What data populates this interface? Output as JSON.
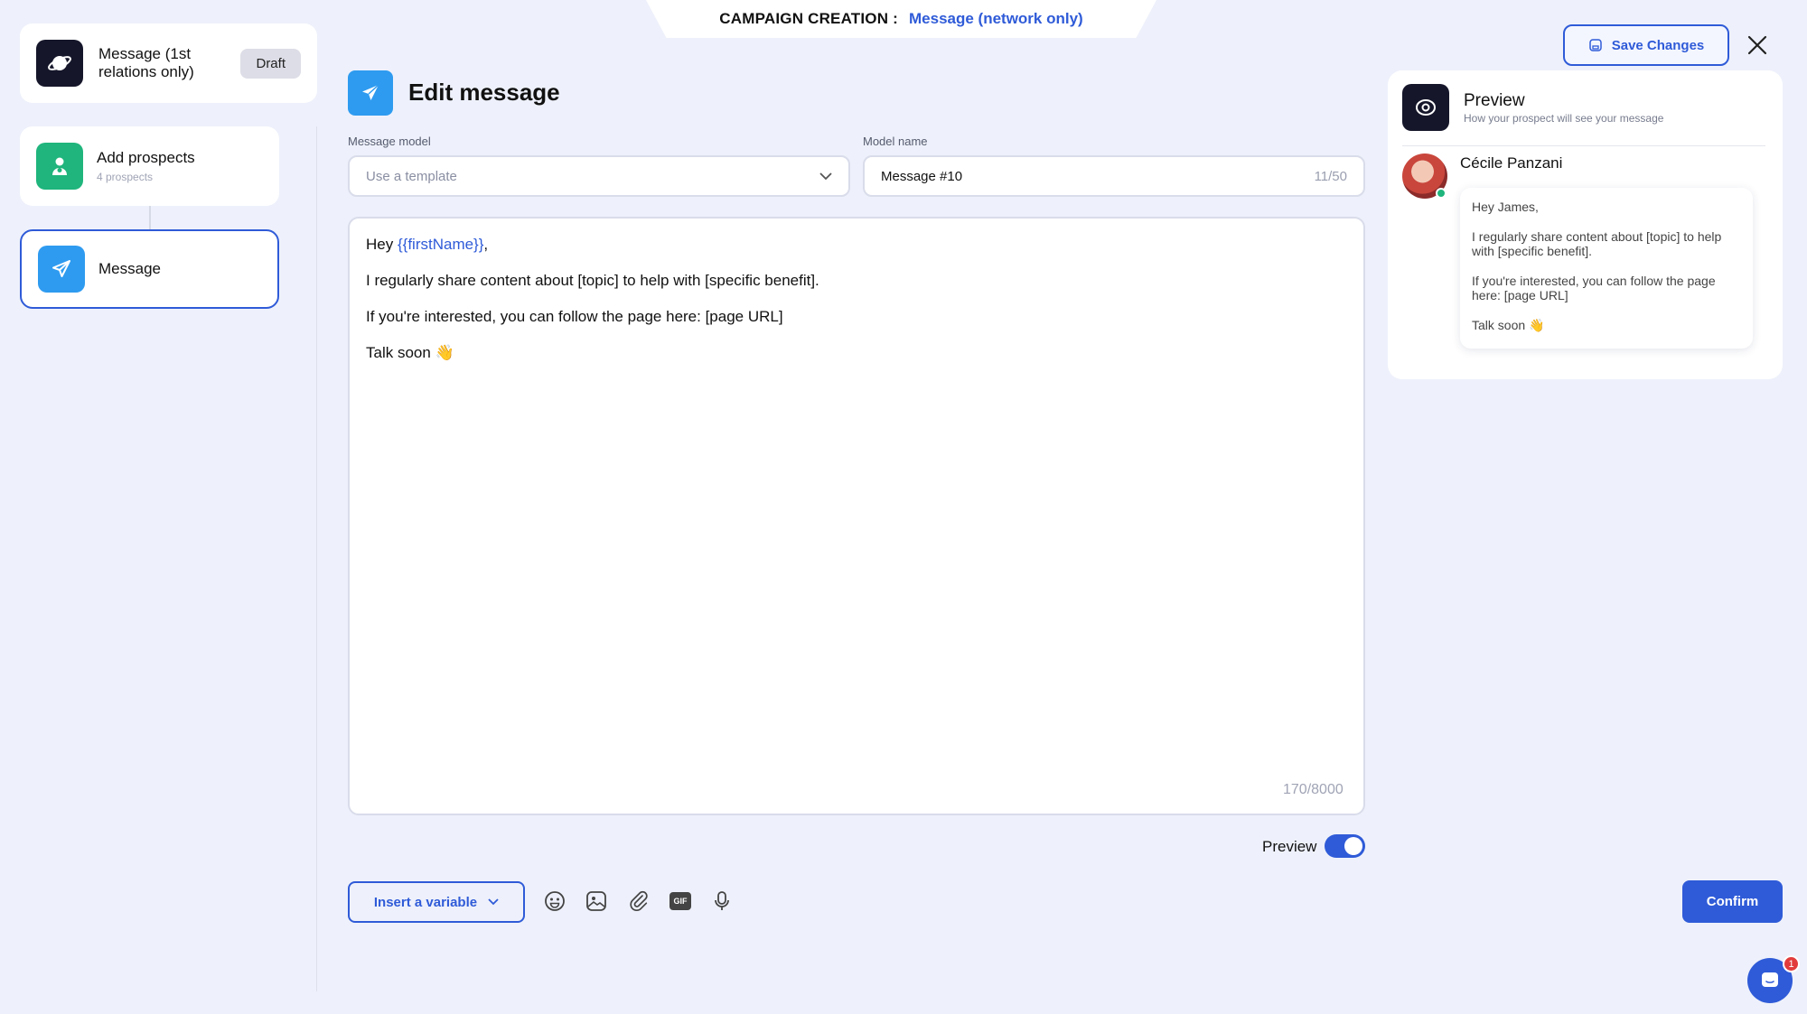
{
  "header": {
    "label": "CAMPAIGN CREATION :",
    "value": "Message (network only)"
  },
  "sidebar": {
    "campaign": {
      "title": "Message (1st relations only)",
      "status": "Draft"
    },
    "steps": [
      {
        "title": "Add prospects",
        "subtitle": "4 prospects"
      },
      {
        "title": "Message",
        "subtitle": ""
      }
    ]
  },
  "editor": {
    "title": "Edit message",
    "model_label": "Message model",
    "model_placeholder": "Use a template",
    "name_label": "Model name",
    "name_value": "Message #10",
    "name_count": "11/50",
    "greeting_prefix": "Hey ",
    "greeting_var": "{{firstName}}",
    "greeting_suffix": ",",
    "line2": "I regularly share content about [topic] to help with [specific benefit].",
    "line3": "If you're interested, you can follow the page here: [page URL]",
    "line4": "Talk soon 👋",
    "char_count": "170/8000",
    "preview_toggle_label": "Preview",
    "insert_variable": "Insert a variable"
  },
  "toolbar": {
    "icons": [
      "emoji-icon",
      "image-icon",
      "attachment-icon",
      "gif-icon",
      "microphone-icon"
    ],
    "gif_text": "GIF"
  },
  "actions": {
    "save": "Save Changes",
    "confirm": "Confirm"
  },
  "preview": {
    "title": "Preview",
    "subtitle": "How your prospect will see your message",
    "sender": "Cécile Panzani",
    "msg1": "Hey James,",
    "msg2": "I regularly share content about [topic] to help with [specific benefit].",
    "msg3": "If you're interested, you can follow the page here: [page URL]",
    "msg4": "Talk soon 👋"
  },
  "chat": {
    "badge": "1"
  },
  "colors": {
    "accent": "#2f5bd8",
    "green": "#1fb57c",
    "sky": "#2e9bf0",
    "dark": "#15162a",
    "background": "#eef1fb"
  }
}
